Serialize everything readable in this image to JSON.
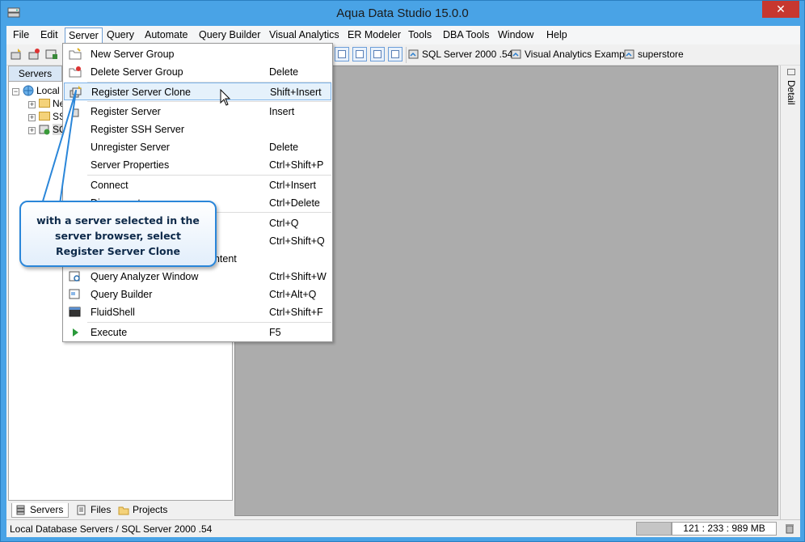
{
  "window": {
    "title": "Aqua Data Studio 15.0.0",
    "close_glyph": "✕"
  },
  "menubar": {
    "items": [
      {
        "label": "File"
      },
      {
        "label": "Edit"
      },
      {
        "label": "Server"
      },
      {
        "label": "Query"
      },
      {
        "label": "Automate"
      },
      {
        "label": "Query Builder"
      },
      {
        "label": "Visual Analytics"
      },
      {
        "label": "ER Modeler"
      },
      {
        "label": "Tools"
      },
      {
        "label": "DBA Tools"
      },
      {
        "label": "Window"
      },
      {
        "label": "Help"
      }
    ],
    "active": "Server"
  },
  "toolbar": {
    "links": [
      {
        "label": "SQL Server 2000 .54"
      },
      {
        "label": "Visual Analytics Example"
      },
      {
        "label": "superstore"
      }
    ]
  },
  "server_panel": {
    "tab_label": "Servers",
    "tree": [
      {
        "label": "Local"
      },
      {
        "label": "Ne"
      },
      {
        "label": "SS"
      },
      {
        "label": "SQ"
      }
    ]
  },
  "bottom_tabs": [
    {
      "label": "Servers"
    },
    {
      "label": "Files"
    },
    {
      "label": "Projects"
    }
  ],
  "detail_panel": {
    "label": "Detail"
  },
  "server_menu": {
    "items": [
      {
        "label": "New Server Group",
        "shortcut": ""
      },
      {
        "label": "Delete Server Group",
        "shortcut": "Delete"
      },
      {
        "label": "Register Server Clone",
        "shortcut": "Shift+Insert"
      },
      {
        "label": "Register Server",
        "shortcut": "Insert"
      },
      {
        "label": "Register SSH Server",
        "shortcut": ""
      },
      {
        "label": "Unregister Server",
        "shortcut": "Delete"
      },
      {
        "label": "Server Properties",
        "shortcut": "Ctrl+Shift+P"
      },
      {
        "label": "Connect",
        "shortcut": "Ctrl+Insert"
      },
      {
        "label": "Disconnect",
        "shortcut": "Ctrl+Delete"
      },
      {
        "label": "",
        "shortcut": "Ctrl+Q"
      },
      {
        "label": "",
        "shortcut": "Ctrl+Shift+Q"
      },
      {
        "label": "ontent",
        "shortcut": ""
      },
      {
        "label": "Query Analyzer Window",
        "shortcut": "Ctrl+Shift+W"
      },
      {
        "label": "Query Builder",
        "shortcut": "Ctrl+Alt+Q"
      },
      {
        "label": "FluidShell",
        "shortcut": "Ctrl+Shift+F"
      },
      {
        "label": "Execute",
        "shortcut": "F5"
      }
    ],
    "highlighted": "Register Server Clone"
  },
  "callout": {
    "line1": "with a server selected in the",
    "line2": "server browser, select",
    "line3": "Register Server Clone"
  },
  "statusbar": {
    "path": "Local Database Servers / SQL Server 2000 .54",
    "memory": "121 : 233 : 989 MB"
  },
  "colors": {
    "title_bar": "#49a3e6",
    "close_button": "#c7372f",
    "menu_hover": "#e5f1fb",
    "menu_hover_border": "#7eb4ea",
    "work_area": "#acacac",
    "callout_border": "#2a86d9"
  }
}
